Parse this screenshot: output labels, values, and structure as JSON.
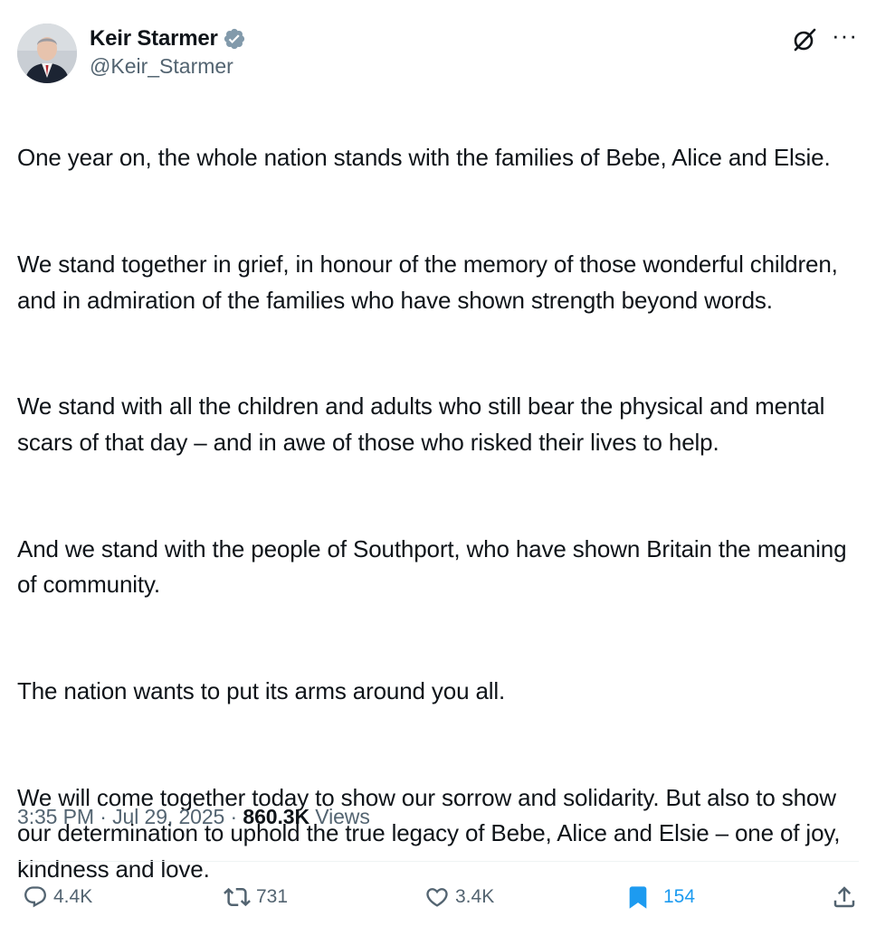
{
  "author": {
    "name": "Keir Starmer",
    "handle": "@Keir_Starmer",
    "verified_color": "#829aab"
  },
  "tweet": {
    "paragraphs": [
      "One year on, the whole nation stands with the families of Bebe, Alice and Elsie.",
      "We stand together in grief, in honour of the memory of those wonderful children, and in admiration of the families who have shown strength beyond words.",
      "We stand with all the children and adults who still bear the physical and mental scars of that day – and in awe of those who risked their lives to help.",
      "And we stand with the people of Southport, who have shown Britain the meaning of community.",
      "The nation wants to put its arms around you all.",
      "We will come together today to show our sorrow and solidarity. But also to show our determination to uphold the true legacy of Bebe, Alice and Elsie – one of joy, kindness and love."
    ]
  },
  "meta": {
    "time": "3:35 PM",
    "separator": "·",
    "date": "Jul 29, 2025",
    "views_count": "860.3K",
    "views_label": "Views"
  },
  "actions": {
    "replies": "4.4K",
    "reposts": "731",
    "likes": "3.4K",
    "bookmarks": "154"
  },
  "icons": [
    "grok-icon",
    "more-icon",
    "reply-icon",
    "repost-icon",
    "like-icon",
    "bookmark-icon",
    "share-icon",
    "verified-icon"
  ],
  "colors": {
    "text": "#0f1419",
    "secondary": "#536471",
    "accent": "#1d9bf0"
  }
}
